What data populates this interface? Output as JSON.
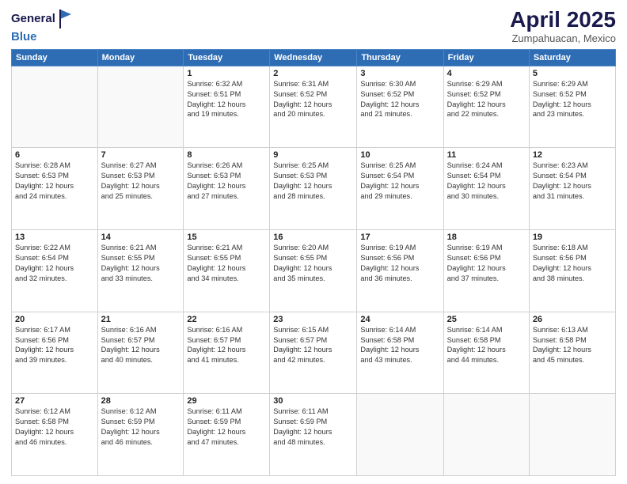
{
  "logo": {
    "line1": "General",
    "line2": "Blue"
  },
  "title": "April 2025",
  "subtitle": "Zumpahuacan, Mexico",
  "days_header": [
    "Sunday",
    "Monday",
    "Tuesday",
    "Wednesday",
    "Thursday",
    "Friday",
    "Saturday"
  ],
  "weeks": [
    [
      {
        "day": "",
        "info": ""
      },
      {
        "day": "",
        "info": ""
      },
      {
        "day": "1",
        "sunrise": "6:32 AM",
        "sunset": "6:51 PM",
        "daylight": "12 hours and 19 minutes."
      },
      {
        "day": "2",
        "sunrise": "6:31 AM",
        "sunset": "6:52 PM",
        "daylight": "12 hours and 20 minutes."
      },
      {
        "day": "3",
        "sunrise": "6:30 AM",
        "sunset": "6:52 PM",
        "daylight": "12 hours and 21 minutes."
      },
      {
        "day": "4",
        "sunrise": "6:29 AM",
        "sunset": "6:52 PM",
        "daylight": "12 hours and 22 minutes."
      },
      {
        "day": "5",
        "sunrise": "6:29 AM",
        "sunset": "6:52 PM",
        "daylight": "12 hours and 23 minutes."
      }
    ],
    [
      {
        "day": "6",
        "sunrise": "6:28 AM",
        "sunset": "6:53 PM",
        "daylight": "12 hours and 24 minutes."
      },
      {
        "day": "7",
        "sunrise": "6:27 AM",
        "sunset": "6:53 PM",
        "daylight": "12 hours and 25 minutes."
      },
      {
        "day": "8",
        "sunrise": "6:26 AM",
        "sunset": "6:53 PM",
        "daylight": "12 hours and 27 minutes."
      },
      {
        "day": "9",
        "sunrise": "6:25 AM",
        "sunset": "6:53 PM",
        "daylight": "12 hours and 28 minutes."
      },
      {
        "day": "10",
        "sunrise": "6:25 AM",
        "sunset": "6:54 PM",
        "daylight": "12 hours and 29 minutes."
      },
      {
        "day": "11",
        "sunrise": "6:24 AM",
        "sunset": "6:54 PM",
        "daylight": "12 hours and 30 minutes."
      },
      {
        "day": "12",
        "sunrise": "6:23 AM",
        "sunset": "6:54 PM",
        "daylight": "12 hours and 31 minutes."
      }
    ],
    [
      {
        "day": "13",
        "sunrise": "6:22 AM",
        "sunset": "6:54 PM",
        "daylight": "12 hours and 32 minutes."
      },
      {
        "day": "14",
        "sunrise": "6:21 AM",
        "sunset": "6:55 PM",
        "daylight": "12 hours and 33 minutes."
      },
      {
        "day": "15",
        "sunrise": "6:21 AM",
        "sunset": "6:55 PM",
        "daylight": "12 hours and 34 minutes."
      },
      {
        "day": "16",
        "sunrise": "6:20 AM",
        "sunset": "6:55 PM",
        "daylight": "12 hours and 35 minutes."
      },
      {
        "day": "17",
        "sunrise": "6:19 AM",
        "sunset": "6:56 PM",
        "daylight": "12 hours and 36 minutes."
      },
      {
        "day": "18",
        "sunrise": "6:19 AM",
        "sunset": "6:56 PM",
        "daylight": "12 hours and 37 minutes."
      },
      {
        "day": "19",
        "sunrise": "6:18 AM",
        "sunset": "6:56 PM",
        "daylight": "12 hours and 38 minutes."
      }
    ],
    [
      {
        "day": "20",
        "sunrise": "6:17 AM",
        "sunset": "6:56 PM",
        "daylight": "12 hours and 39 minutes."
      },
      {
        "day": "21",
        "sunrise": "6:16 AM",
        "sunset": "6:57 PM",
        "daylight": "12 hours and 40 minutes."
      },
      {
        "day": "22",
        "sunrise": "6:16 AM",
        "sunset": "6:57 PM",
        "daylight": "12 hours and 41 minutes."
      },
      {
        "day": "23",
        "sunrise": "6:15 AM",
        "sunset": "6:57 PM",
        "daylight": "12 hours and 42 minutes."
      },
      {
        "day": "24",
        "sunrise": "6:14 AM",
        "sunset": "6:58 PM",
        "daylight": "12 hours and 43 minutes."
      },
      {
        "day": "25",
        "sunrise": "6:14 AM",
        "sunset": "6:58 PM",
        "daylight": "12 hours and 44 minutes."
      },
      {
        "day": "26",
        "sunrise": "6:13 AM",
        "sunset": "6:58 PM",
        "daylight": "12 hours and 45 minutes."
      }
    ],
    [
      {
        "day": "27",
        "sunrise": "6:12 AM",
        "sunset": "6:58 PM",
        "daylight": "12 hours and 46 minutes."
      },
      {
        "day": "28",
        "sunrise": "6:12 AM",
        "sunset": "6:59 PM",
        "daylight": "12 hours and 46 minutes."
      },
      {
        "day": "29",
        "sunrise": "6:11 AM",
        "sunset": "6:59 PM",
        "daylight": "12 hours and 47 minutes."
      },
      {
        "day": "30",
        "sunrise": "6:11 AM",
        "sunset": "6:59 PM",
        "daylight": "12 hours and 48 minutes."
      },
      {
        "day": "",
        "info": ""
      },
      {
        "day": "",
        "info": ""
      },
      {
        "day": "",
        "info": ""
      }
    ]
  ]
}
